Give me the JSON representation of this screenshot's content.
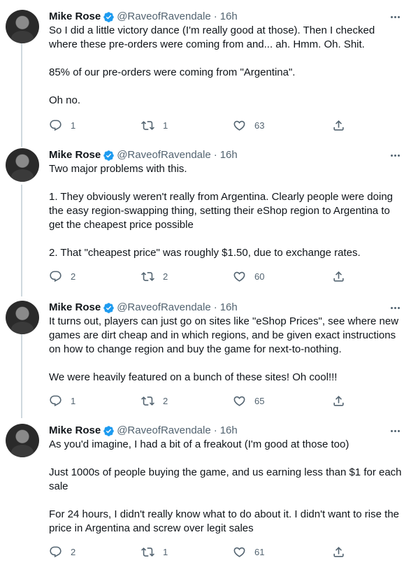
{
  "tweets": [
    {
      "name": "Mike Rose",
      "handle": "@RaveofRavendale",
      "sep": "·",
      "time": "16h",
      "paragraphs": [
        "So I did a little victory dance (I'm really good at those). Then I checked where these pre-orders were coming from and... ah. Hmm. Oh. Shit.",
        "85% of our pre-orders were coming from \"Argentina\".",
        "Oh no."
      ],
      "replies": "1",
      "retweets": "1",
      "likes": "63"
    },
    {
      "name": "Mike Rose",
      "handle": "@RaveofRavendale",
      "sep": "·",
      "time": "16h",
      "paragraphs": [
        "Two major problems with this.",
        "1. They obviously weren't really from Argentina. Clearly people were doing the easy region-swapping thing, setting their eShop region to Argentina to get the cheapest price possible",
        "2. That \"cheapest price\" was roughly $1.50, due to exchange rates."
      ],
      "replies": "2",
      "retweets": "2",
      "likes": "60"
    },
    {
      "name": "Mike Rose",
      "handle": "@RaveofRavendale",
      "sep": "·",
      "time": "16h",
      "paragraphs": [
        "It turns out, players can just go on sites like \"eShop Prices\", see where new games are dirt cheap and in which regions, and be given exact instructions on how to change region and buy the game for next-to-nothing.",
        "We were heavily featured on a bunch of these sites! Oh cool!!!"
      ],
      "replies": "1",
      "retweets": "2",
      "likes": "65"
    },
    {
      "name": "Mike Rose",
      "handle": "@RaveofRavendale",
      "sep": "·",
      "time": "16h",
      "paragraphs": [
        "As you'd imagine, I had a bit of a freakout (I'm good at those too)",
        "Just 1000s of people buying the game, and us earning less than $1 for each sale",
        "For 24 hours, I didn't really know what to do about it. I didn't want to rise the price in Argentina and screw over legit sales"
      ],
      "replies": "2",
      "retweets": "1",
      "likes": "61"
    }
  ],
  "colors": {
    "text": "#0f1419",
    "secondary": "#536471",
    "verified": "#1d9bf0",
    "thread_line": "#cfd9de"
  },
  "icons": [
    "verified-badge-icon",
    "more-icon",
    "reply-icon",
    "retweet-icon",
    "like-icon",
    "share-icon"
  ]
}
